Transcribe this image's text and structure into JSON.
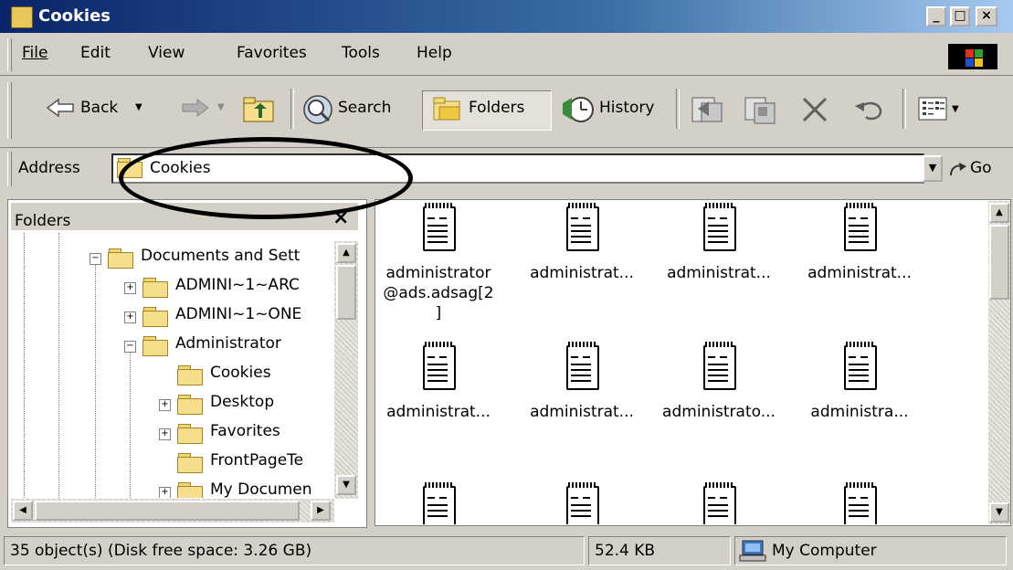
{
  "window": {
    "title": "Cookies",
    "minimize": "_",
    "maximize": "□",
    "close": "×"
  },
  "menu": [
    {
      "label": "File"
    },
    {
      "label": "Edit"
    },
    {
      "label": "View"
    },
    {
      "label": "Favorites"
    },
    {
      "label": "Tools"
    },
    {
      "label": "Help"
    }
  ],
  "toolbar": {
    "back_label": "Back",
    "search_label": "Search",
    "folders_label": "Folders",
    "history_label": "History"
  },
  "address": {
    "label": "Address",
    "value": "Cookies",
    "go_label": "Go"
  },
  "folders_panel": {
    "title": "Folders",
    "close": "×",
    "items": [
      {
        "label": "Documents and Sett",
        "expander": "−"
      },
      {
        "label": "ADMINI~1~ARC",
        "expander": "+"
      },
      {
        "label": "ADMINI~1~ONE",
        "expander": "+"
      },
      {
        "label": "Administrator",
        "expander": "−"
      },
      {
        "label": "Cookies",
        "expander": ""
      },
      {
        "label": "Desktop",
        "expander": "+"
      },
      {
        "label": "Favorites",
        "expander": "+"
      },
      {
        "label": "FrontPageTe",
        "expander": ""
      },
      {
        "label": "My Documen",
        "expander": "+"
      }
    ]
  },
  "files": [
    {
      "line1": "administrator",
      "line2": "@ads.adsag[2",
      "line3": "]"
    },
    {
      "line1": "administrat..."
    },
    {
      "line1": "administrat..."
    },
    {
      "line1": "administrat..."
    },
    {
      "line1": "administrat..."
    },
    {
      "line1": "administrat..."
    },
    {
      "line1": "administrato..."
    },
    {
      "line1": "administra..."
    },
    {
      "line1": ""
    },
    {
      "line1": ""
    },
    {
      "line1": ""
    },
    {
      "line1": ""
    }
  ],
  "status": {
    "objects": "35 object(s) (Disk free space: 3.26 GB)",
    "size": "52.4 KB",
    "zone": "My Computer"
  }
}
